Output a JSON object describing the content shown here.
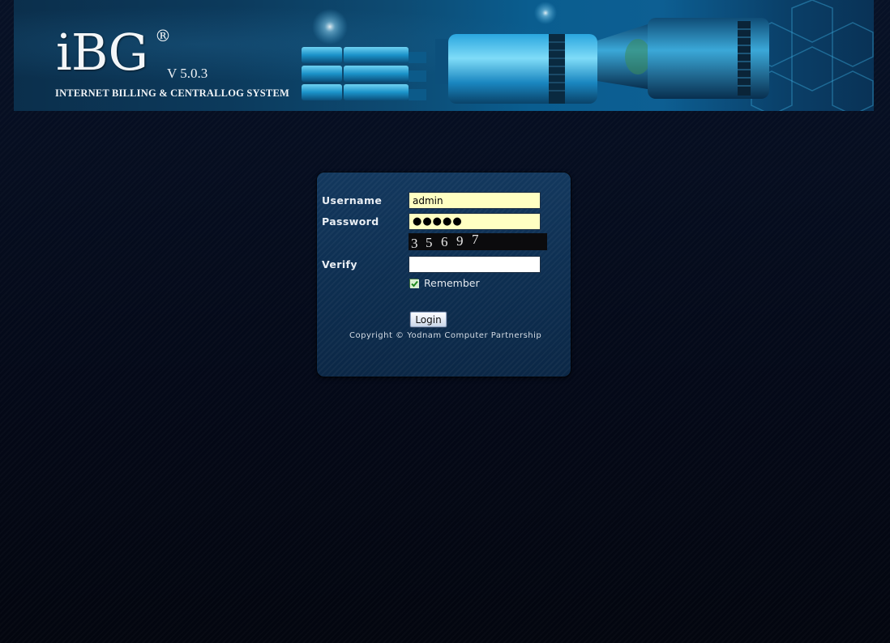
{
  "header": {
    "logo_text": "iBG",
    "registered_mark": "®",
    "version": "V 5.0.3",
    "subtitle": "INTERNET BILLING & CENTRALLOG SYSTEM"
  },
  "login": {
    "username_label": "Username",
    "username_value": "admin",
    "password_label": "Password",
    "password_masked": "●●●●●",
    "captcha_digits": [
      "3",
      "5",
      "6",
      "9",
      "7"
    ],
    "verify_label": "Verify",
    "verify_value": "",
    "remember_label": "Remember",
    "remember_checked": true,
    "login_button": "Login",
    "copyright": "Copyright © Yodnam Computer Partnership"
  },
  "colors": {
    "page_background": "#050a16",
    "panel_background": "#0d2e50",
    "input_filled": "#ffffc2",
    "input_empty": "#ffffff",
    "banner_accent": "#0a5d8f"
  }
}
